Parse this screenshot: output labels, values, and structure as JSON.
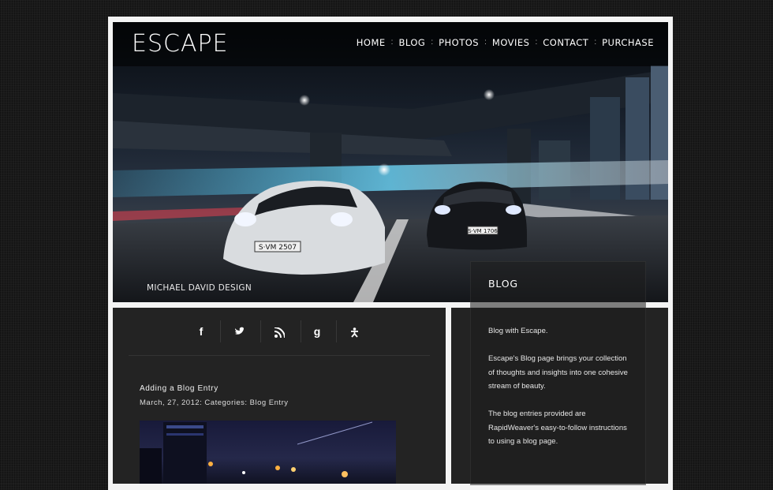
{
  "site": {
    "logo": "ESCAPE",
    "credit": "MICHAEL DAVID DESIGN"
  },
  "nav": {
    "items": [
      {
        "label": "HOME"
      },
      {
        "label": "BLOG"
      },
      {
        "label": "PHOTOS"
      },
      {
        "label": "MOVIES"
      },
      {
        "label": "CONTACT"
      },
      {
        "label": "PURCHASE"
      }
    ],
    "separator": ":"
  },
  "hero": {
    "car1_plate": "S·VM 2507",
    "car2_plate": "S·VM 1706"
  },
  "social": {
    "icons": [
      {
        "name": "facebook-icon",
        "glyph": "f"
      },
      {
        "name": "twitter-icon",
        "glyph": "🐦"
      },
      {
        "name": "rss-icon",
        "glyph": "◉"
      },
      {
        "name": "google-icon",
        "glyph": "g"
      },
      {
        "name": "delicious-icon",
        "glyph": "✱"
      }
    ]
  },
  "post": {
    "title": "Adding a Blog Entry",
    "meta_prefix": "March, 27, 2012: Categories:",
    "category": "Blog Entry"
  },
  "sidebar": {
    "title": "BLOG",
    "p1": "Blog with Escape.",
    "p2": "Escape's Blog page brings your collection of thoughts and insights  into one cohesive stream of beauty.",
    "p3": "The blog entries provided are RapidWeaver's easy-to-follow instructions to using a blog page."
  },
  "colors": {
    "background": "#1a1a1a",
    "frame": "#f4f4f4",
    "panel": "#232323",
    "accent_light": "#4fd0ff"
  }
}
